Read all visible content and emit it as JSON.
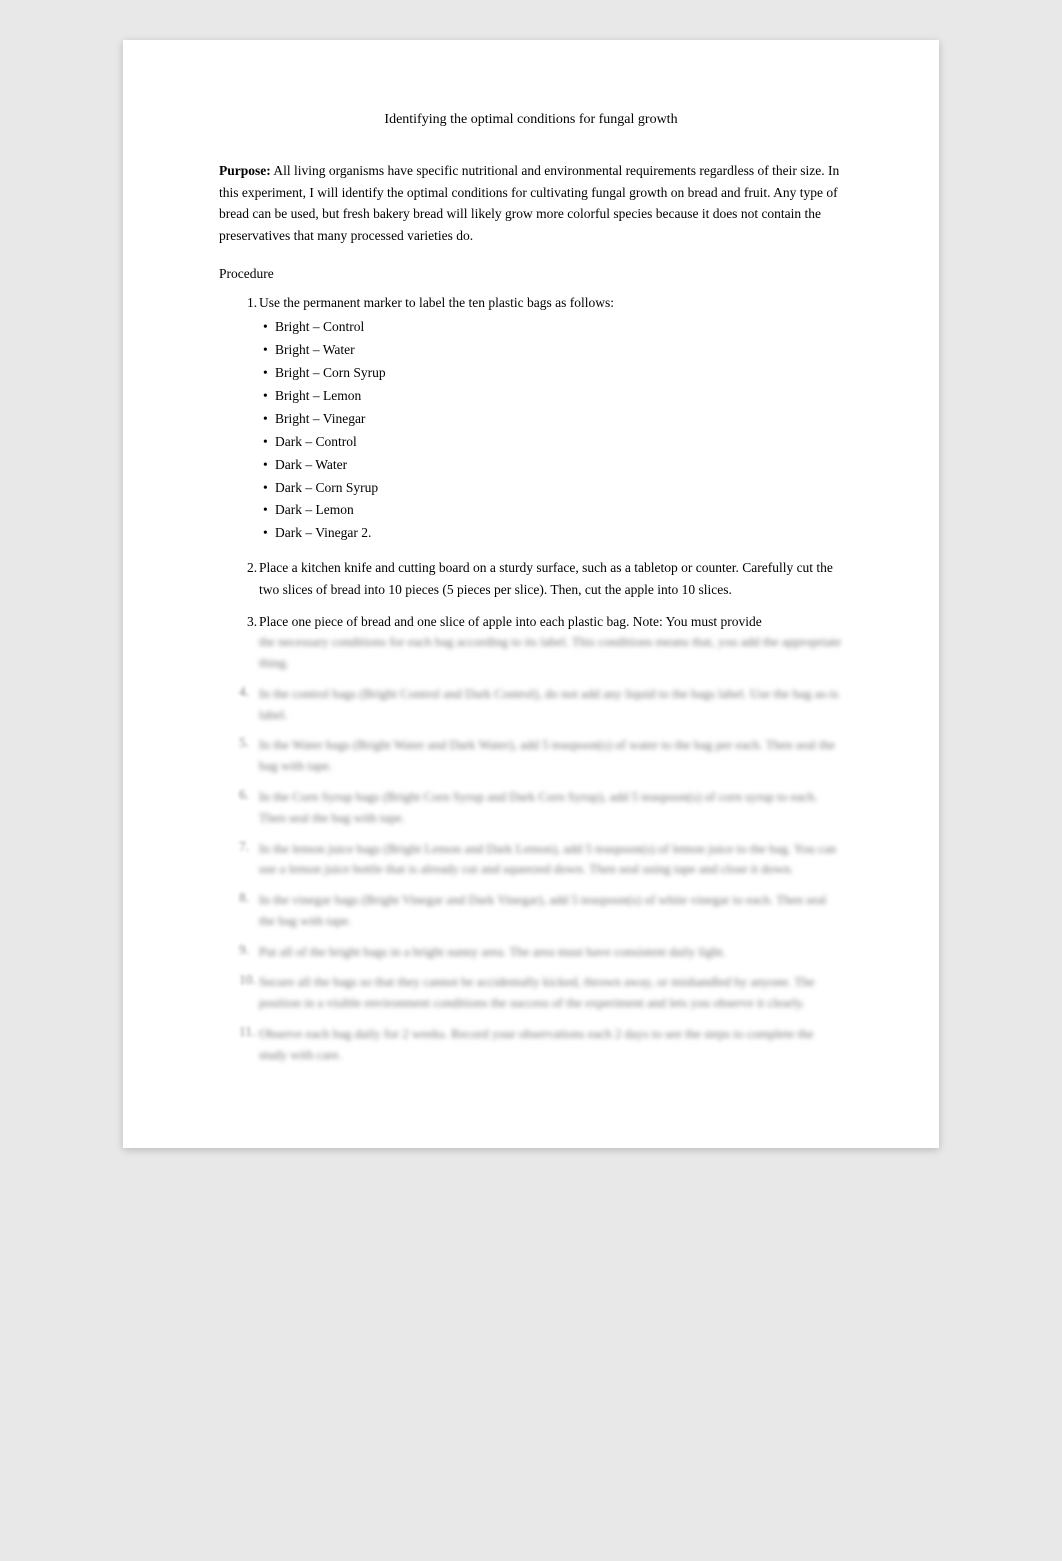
{
  "page": {
    "title": "Identifying the optimal conditions for fungal growth",
    "purpose": {
      "label": "Purpose:",
      "text": " All living organisms have specific nutritional and environmental requirements regardless of their size. In this experiment, I will identify the optimal conditions for cultivating fungal growth on bread and fruit. Any type of bread can be used, but fresh bakery bread will likely grow more colorful species because it does not contain the preservatives that many processed varieties do."
    },
    "procedure": {
      "heading": "Procedure",
      "steps": [
        {
          "num": "1.",
          "text": "Use the permanent marker to label the ten plastic bags as follows:",
          "subitems": [
            "Bright – Control",
            "Bright – Water",
            "Bright – Corn Syrup",
            "Bright – Lemon",
            "Bright – Vinegar",
            "Dark – Control",
            "Dark – Water",
            "Dark – Corn Syrup",
            "Dark – Lemon",
            "Dark – Vinegar 2."
          ]
        },
        {
          "num": "2.",
          "text": "Place a kitchen knife and cutting board on a sturdy surface, such as a tabletop or counter. Carefully cut the two slices of bread into 10 pieces (5 pieces per slice). Then, cut the apple into 10 slices."
        },
        {
          "num": "3.",
          "text": "Place one piece of bread and one slice of apple into each plastic bag. Note: You must provide"
        }
      ],
      "blurred_steps": [
        {
          "num": "4.",
          "lines": 2
        },
        {
          "num": "5.",
          "lines": 2
        },
        {
          "num": "6.",
          "lines": 2
        },
        {
          "num": "7.",
          "lines": 3
        },
        {
          "num": "8.",
          "lines": 2
        },
        {
          "num": "9.",
          "lines": 2
        },
        {
          "num": "10.",
          "lines": 3
        },
        {
          "num": "11.",
          "lines": 2
        }
      ]
    }
  }
}
